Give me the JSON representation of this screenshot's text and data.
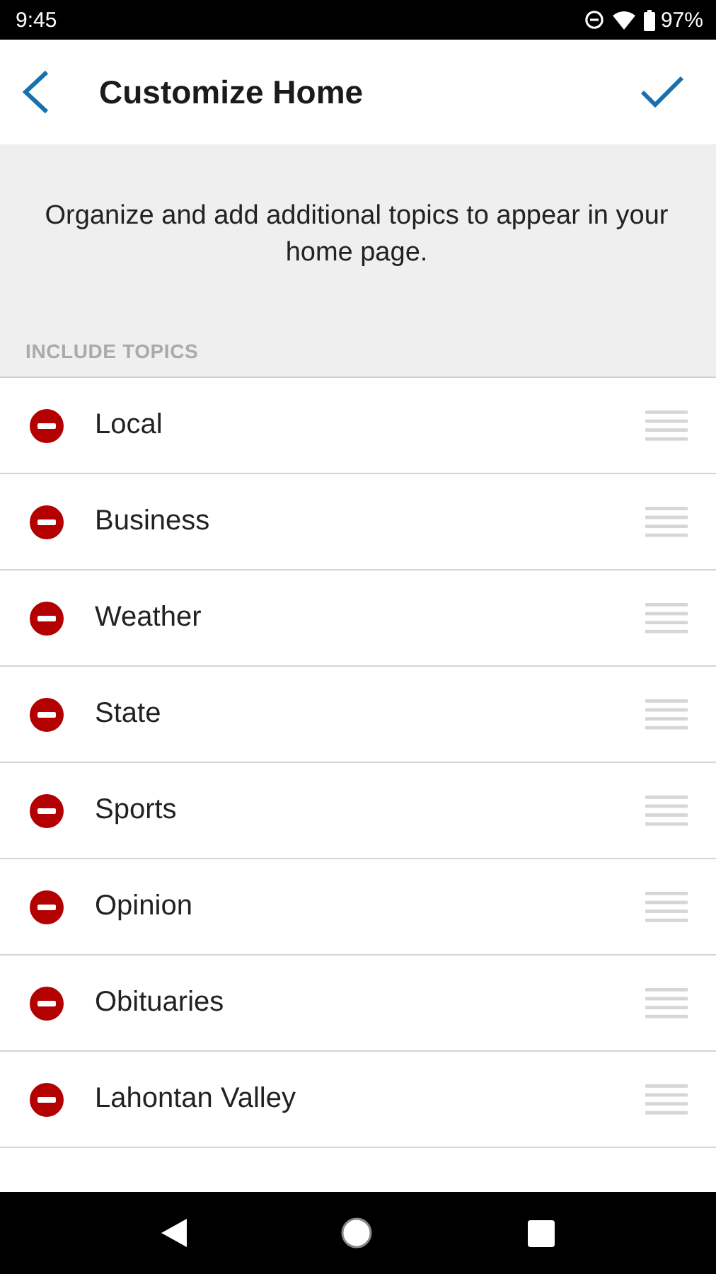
{
  "status_bar": {
    "time": "9:45",
    "battery": "97%"
  },
  "header": {
    "title": "Customize Home"
  },
  "intro": {
    "text": "Organize and add additional topics to appear in your home page."
  },
  "section": {
    "label": "INCLUDE TOPICS"
  },
  "topics": [
    {
      "label": "Local"
    },
    {
      "label": "Business"
    },
    {
      "label": "Weather"
    },
    {
      "label": "State"
    },
    {
      "label": "Sports"
    },
    {
      "label": "Opinion"
    },
    {
      "label": "Obituaries"
    },
    {
      "label": "Lahontan Valley"
    }
  ]
}
